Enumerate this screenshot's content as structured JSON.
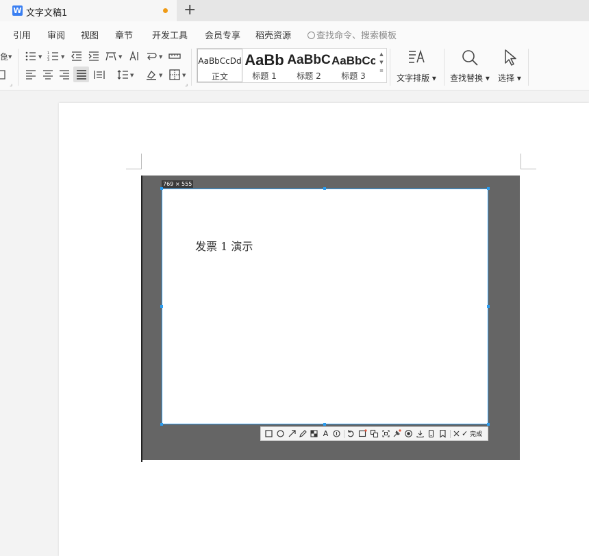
{
  "tab": {
    "title": "文字文稿1",
    "app_icon": "W"
  },
  "menu": [
    "引用",
    "审阅",
    "视图",
    "章节",
    "开发工具",
    "会员专享",
    "稻壳资源"
  ],
  "search_placeholder": "查找命令、搜索模板",
  "styles": [
    {
      "sample": "AaBbCcDd",
      "label": "正文"
    },
    {
      "sample": "AaBb",
      "label": "标题 1"
    },
    {
      "sample": "AaBbC",
      "label": "标题 2"
    },
    {
      "sample": "AaBbCc",
      "label": "标题 3"
    }
  ],
  "ribbon_buttons": {
    "text_layout": "文字排版",
    "find_replace": "查找替换",
    "select": "选择"
  },
  "screenshot": {
    "dimensions": "769 × 555",
    "text": "发票 1 演示",
    "done": "完成"
  },
  "colors": {
    "accent": "#2a9cf0",
    "tab_dot": "#ef9b16",
    "app_blue": "#3a7ff2",
    "shot_bg": "#656565"
  }
}
